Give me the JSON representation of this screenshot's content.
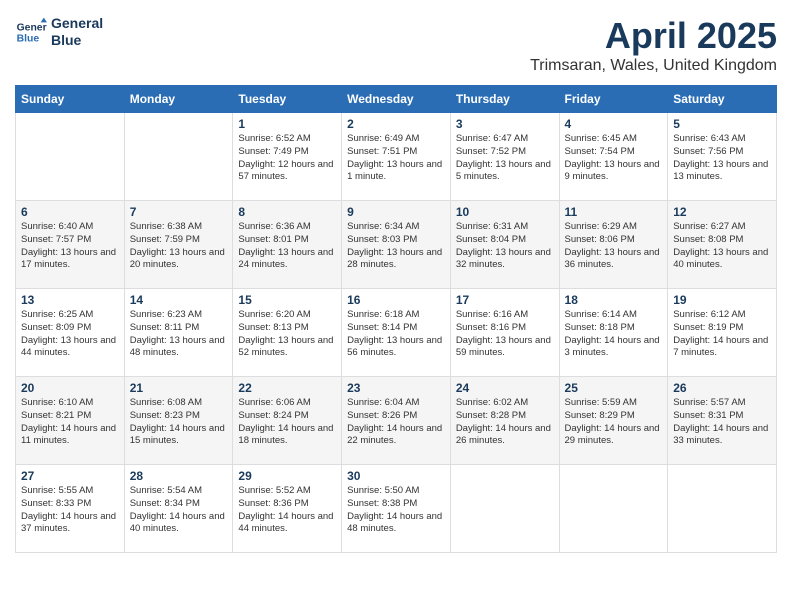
{
  "header": {
    "logo_line1": "General",
    "logo_line2": "Blue",
    "month": "April 2025",
    "location": "Trimsaran, Wales, United Kingdom"
  },
  "weekdays": [
    "Sunday",
    "Monday",
    "Tuesday",
    "Wednesday",
    "Thursday",
    "Friday",
    "Saturday"
  ],
  "weeks": [
    [
      null,
      null,
      {
        "day": "1",
        "sunrise": "Sunrise: 6:52 AM",
        "sunset": "Sunset: 7:49 PM",
        "daylight": "Daylight: 12 hours and 57 minutes."
      },
      {
        "day": "2",
        "sunrise": "Sunrise: 6:49 AM",
        "sunset": "Sunset: 7:51 PM",
        "daylight": "Daylight: 13 hours and 1 minute."
      },
      {
        "day": "3",
        "sunrise": "Sunrise: 6:47 AM",
        "sunset": "Sunset: 7:52 PM",
        "daylight": "Daylight: 13 hours and 5 minutes."
      },
      {
        "day": "4",
        "sunrise": "Sunrise: 6:45 AM",
        "sunset": "Sunset: 7:54 PM",
        "daylight": "Daylight: 13 hours and 9 minutes."
      },
      {
        "day": "5",
        "sunrise": "Sunrise: 6:43 AM",
        "sunset": "Sunset: 7:56 PM",
        "daylight": "Daylight: 13 hours and 13 minutes."
      }
    ],
    [
      {
        "day": "6",
        "sunrise": "Sunrise: 6:40 AM",
        "sunset": "Sunset: 7:57 PM",
        "daylight": "Daylight: 13 hours and 17 minutes."
      },
      {
        "day": "7",
        "sunrise": "Sunrise: 6:38 AM",
        "sunset": "Sunset: 7:59 PM",
        "daylight": "Daylight: 13 hours and 20 minutes."
      },
      {
        "day": "8",
        "sunrise": "Sunrise: 6:36 AM",
        "sunset": "Sunset: 8:01 PM",
        "daylight": "Daylight: 13 hours and 24 minutes."
      },
      {
        "day": "9",
        "sunrise": "Sunrise: 6:34 AM",
        "sunset": "Sunset: 8:03 PM",
        "daylight": "Daylight: 13 hours and 28 minutes."
      },
      {
        "day": "10",
        "sunrise": "Sunrise: 6:31 AM",
        "sunset": "Sunset: 8:04 PM",
        "daylight": "Daylight: 13 hours and 32 minutes."
      },
      {
        "day": "11",
        "sunrise": "Sunrise: 6:29 AM",
        "sunset": "Sunset: 8:06 PM",
        "daylight": "Daylight: 13 hours and 36 minutes."
      },
      {
        "day": "12",
        "sunrise": "Sunrise: 6:27 AM",
        "sunset": "Sunset: 8:08 PM",
        "daylight": "Daylight: 13 hours and 40 minutes."
      }
    ],
    [
      {
        "day": "13",
        "sunrise": "Sunrise: 6:25 AM",
        "sunset": "Sunset: 8:09 PM",
        "daylight": "Daylight: 13 hours and 44 minutes."
      },
      {
        "day": "14",
        "sunrise": "Sunrise: 6:23 AM",
        "sunset": "Sunset: 8:11 PM",
        "daylight": "Daylight: 13 hours and 48 minutes."
      },
      {
        "day": "15",
        "sunrise": "Sunrise: 6:20 AM",
        "sunset": "Sunset: 8:13 PM",
        "daylight": "Daylight: 13 hours and 52 minutes."
      },
      {
        "day": "16",
        "sunrise": "Sunrise: 6:18 AM",
        "sunset": "Sunset: 8:14 PM",
        "daylight": "Daylight: 13 hours and 56 minutes."
      },
      {
        "day": "17",
        "sunrise": "Sunrise: 6:16 AM",
        "sunset": "Sunset: 8:16 PM",
        "daylight": "Daylight: 13 hours and 59 minutes."
      },
      {
        "day": "18",
        "sunrise": "Sunrise: 6:14 AM",
        "sunset": "Sunset: 8:18 PM",
        "daylight": "Daylight: 14 hours and 3 minutes."
      },
      {
        "day": "19",
        "sunrise": "Sunrise: 6:12 AM",
        "sunset": "Sunset: 8:19 PM",
        "daylight": "Daylight: 14 hours and 7 minutes."
      }
    ],
    [
      {
        "day": "20",
        "sunrise": "Sunrise: 6:10 AM",
        "sunset": "Sunset: 8:21 PM",
        "daylight": "Daylight: 14 hours and 11 minutes."
      },
      {
        "day": "21",
        "sunrise": "Sunrise: 6:08 AM",
        "sunset": "Sunset: 8:23 PM",
        "daylight": "Daylight: 14 hours and 15 minutes."
      },
      {
        "day": "22",
        "sunrise": "Sunrise: 6:06 AM",
        "sunset": "Sunset: 8:24 PM",
        "daylight": "Daylight: 14 hours and 18 minutes."
      },
      {
        "day": "23",
        "sunrise": "Sunrise: 6:04 AM",
        "sunset": "Sunset: 8:26 PM",
        "daylight": "Daylight: 14 hours and 22 minutes."
      },
      {
        "day": "24",
        "sunrise": "Sunrise: 6:02 AM",
        "sunset": "Sunset: 8:28 PM",
        "daylight": "Daylight: 14 hours and 26 minutes."
      },
      {
        "day": "25",
        "sunrise": "Sunrise: 5:59 AM",
        "sunset": "Sunset: 8:29 PM",
        "daylight": "Daylight: 14 hours and 29 minutes."
      },
      {
        "day": "26",
        "sunrise": "Sunrise: 5:57 AM",
        "sunset": "Sunset: 8:31 PM",
        "daylight": "Daylight: 14 hours and 33 minutes."
      }
    ],
    [
      {
        "day": "27",
        "sunrise": "Sunrise: 5:55 AM",
        "sunset": "Sunset: 8:33 PM",
        "daylight": "Daylight: 14 hours and 37 minutes."
      },
      {
        "day": "28",
        "sunrise": "Sunrise: 5:54 AM",
        "sunset": "Sunset: 8:34 PM",
        "daylight": "Daylight: 14 hours and 40 minutes."
      },
      {
        "day": "29",
        "sunrise": "Sunrise: 5:52 AM",
        "sunset": "Sunset: 8:36 PM",
        "daylight": "Daylight: 14 hours and 44 minutes."
      },
      {
        "day": "30",
        "sunrise": "Sunrise: 5:50 AM",
        "sunset": "Sunset: 8:38 PM",
        "daylight": "Daylight: 14 hours and 48 minutes."
      },
      null,
      null,
      null
    ]
  ]
}
